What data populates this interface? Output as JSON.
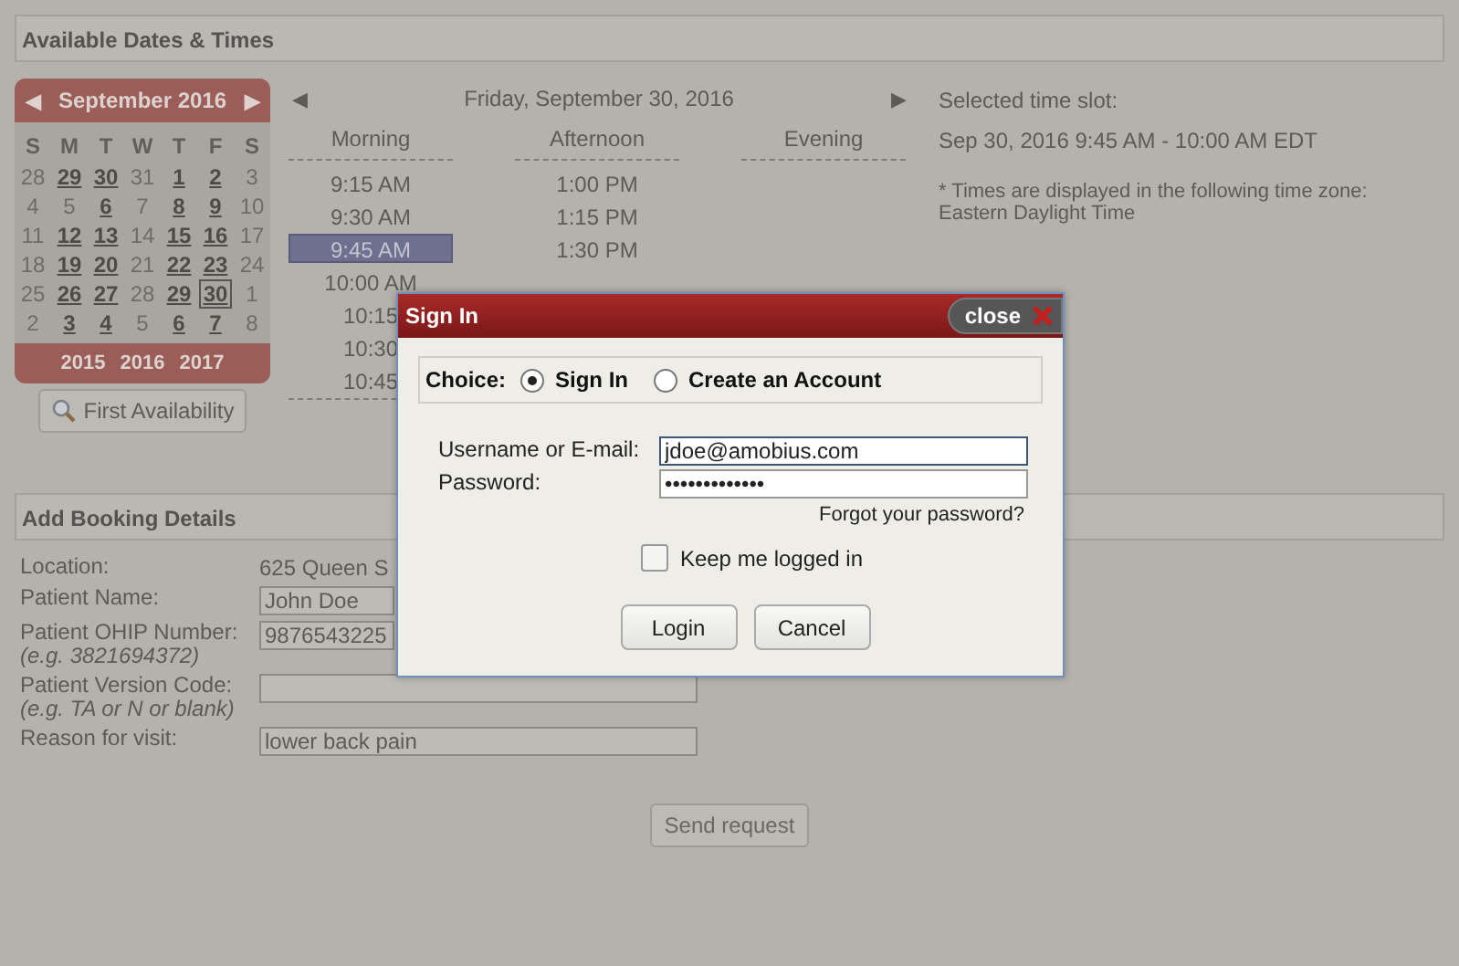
{
  "dates_section": {
    "title": "Available Dates & Times"
  },
  "calendar": {
    "month": "September 2016",
    "prev": "◀",
    "next": "▶",
    "weekdays": [
      "S",
      "M",
      "T",
      "W",
      "T",
      "F",
      "S"
    ],
    "weeks": [
      [
        {
          "day": "28",
          "available": false,
          "selected": false
        },
        {
          "day": "29",
          "available": true,
          "selected": false
        },
        {
          "day": "30",
          "available": true,
          "selected": false
        },
        {
          "day": "31",
          "available": false,
          "selected": false
        },
        {
          "day": "1",
          "available": true,
          "selected": false
        },
        {
          "day": "2",
          "available": true,
          "selected": false
        },
        {
          "day": "3",
          "available": false,
          "selected": false
        }
      ],
      [
        {
          "day": "4",
          "available": false,
          "selected": false
        },
        {
          "day": "5",
          "available": false,
          "selected": false
        },
        {
          "day": "6",
          "available": true,
          "selected": false
        },
        {
          "day": "7",
          "available": false,
          "selected": false
        },
        {
          "day": "8",
          "available": true,
          "selected": false
        },
        {
          "day": "9",
          "available": true,
          "selected": false
        },
        {
          "day": "10",
          "available": false,
          "selected": false
        }
      ],
      [
        {
          "day": "11",
          "available": false,
          "selected": false
        },
        {
          "day": "12",
          "available": true,
          "selected": false
        },
        {
          "day": "13",
          "available": true,
          "selected": false
        },
        {
          "day": "14",
          "available": false,
          "selected": false
        },
        {
          "day": "15",
          "available": true,
          "selected": false
        },
        {
          "day": "16",
          "available": true,
          "selected": false
        },
        {
          "day": "17",
          "available": false,
          "selected": false
        }
      ],
      [
        {
          "day": "18",
          "available": false,
          "selected": false
        },
        {
          "day": "19",
          "available": true,
          "selected": false
        },
        {
          "day": "20",
          "available": true,
          "selected": false
        },
        {
          "day": "21",
          "available": false,
          "selected": false
        },
        {
          "day": "22",
          "available": true,
          "selected": false
        },
        {
          "day": "23",
          "available": true,
          "selected": false
        },
        {
          "day": "24",
          "available": false,
          "selected": false
        }
      ],
      [
        {
          "day": "25",
          "available": false,
          "selected": false
        },
        {
          "day": "26",
          "available": true,
          "selected": false
        },
        {
          "day": "27",
          "available": true,
          "selected": false
        },
        {
          "day": "28",
          "available": false,
          "selected": false
        },
        {
          "day": "29",
          "available": true,
          "selected": false
        },
        {
          "day": "30",
          "available": true,
          "selected": true
        },
        {
          "day": "1",
          "available": false,
          "selected": false
        }
      ],
      [
        {
          "day": "2",
          "available": false,
          "selected": false
        },
        {
          "day": "3",
          "available": true,
          "selected": false
        },
        {
          "day": "4",
          "available": true,
          "selected": false
        },
        {
          "day": "5",
          "available": false,
          "selected": false
        },
        {
          "day": "6",
          "available": true,
          "selected": false
        },
        {
          "day": "7",
          "available": true,
          "selected": false
        },
        {
          "day": "8",
          "available": false,
          "selected": false
        }
      ]
    ],
    "years": [
      "2015",
      "2016",
      "2017"
    ]
  },
  "first_availability_button": "First Availability",
  "day_view": {
    "prev": "◀",
    "date": "Friday, September 30, 2016",
    "next": "▶",
    "columns": [
      {
        "label": "Morning",
        "slots": [
          {
            "time": "9:15 AM",
            "selected": false
          },
          {
            "time": "9:30 AM",
            "selected": false
          },
          {
            "time": "9:45 AM",
            "selected": true
          },
          {
            "time": "10:00 AM",
            "selected": false
          },
          {
            "time": "10:15",
            "selected": false
          },
          {
            "time": "10:30",
            "selected": false
          },
          {
            "time": "10:45",
            "selected": false
          }
        ]
      },
      {
        "label": "Afternoon",
        "slots": [
          {
            "time": "1:00 PM",
            "selected": false
          },
          {
            "time": "1:15 PM",
            "selected": false
          },
          {
            "time": "1:30 PM",
            "selected": false
          }
        ]
      },
      {
        "label": "Evening"
      }
    ]
  },
  "selection": {
    "label": "Selected time slot:",
    "value": "Sep 30, 2016 9:45 AM - 10:00 AM EDT",
    "note": "* Times are displayed in the following time zone:",
    "timezone": "Eastern Daylight Time"
  },
  "booking_section": {
    "title": "Add Booking Details"
  },
  "booking_fields": [
    {
      "label": "Location:",
      "kind": "text",
      "value": "625 Queen S"
    },
    {
      "label": "Patient Name:",
      "kind": "input",
      "value": "John Doe"
    },
    {
      "label": "Patient OHIP Number:",
      "hint": "(e.g. 3821694372)",
      "kind": "input",
      "value": "9876543225"
    },
    {
      "label": "Patient Version Code:",
      "hint": "(e.g. TA or N or blank)",
      "kind": "wide-input"
    },
    {
      "label": "Reason for visit:",
      "kind": "wide-input",
      "value": "lower back pain"
    }
  ],
  "send_button": "Send request",
  "dialog": {
    "title": "Sign In",
    "close": "close",
    "choice_label": "Choice:",
    "choices": [
      {
        "label": "Sign In",
        "selected": true
      },
      {
        "label": "Create an Account",
        "selected": false
      }
    ],
    "username_label": "Username or E-mail:",
    "username": "jdoe@amobius.com",
    "password_label": "Password:",
    "password": "•••••••••••••",
    "forgot": "Forgot your password?",
    "keep_logged_in": {
      "label": "Keep me logged in",
      "checked": false
    },
    "buttons": [
      "Login",
      "Cancel"
    ]
  }
}
